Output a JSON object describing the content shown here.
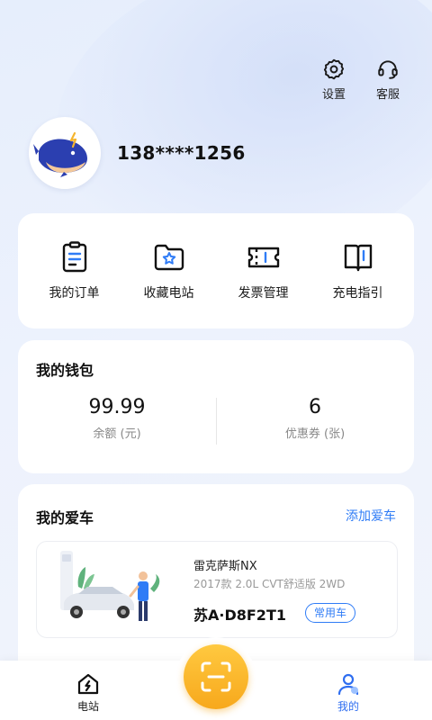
{
  "header": {
    "settings_label": "设置",
    "service_label": "客服"
  },
  "profile": {
    "phone": "138****1256",
    "avatar_icon": "whale-mascot-icon"
  },
  "quick_actions": [
    {
      "label": "我的订单",
      "icon": "order-list-icon"
    },
    {
      "label": "收藏电站",
      "icon": "favorite-station-icon"
    },
    {
      "label": "发票管理",
      "icon": "invoice-ticket-icon"
    },
    {
      "label": "充电指引",
      "icon": "charging-guide-icon"
    }
  ],
  "wallet": {
    "title": "我的钱包",
    "balance_value": "99.99",
    "balance_label": "余额 (元)",
    "coupon_value": "6",
    "coupon_label": "优惠券 (张)"
  },
  "cars": {
    "title": "我的爱车",
    "add_label": "添加爱车",
    "items": [
      {
        "name": "雷克萨斯NX",
        "spec": "2017款 2.0L CVT舒适版 2WD",
        "plate": "苏A·D8F2T1",
        "tag": "常用车"
      }
    ]
  },
  "tabbar": {
    "station_label": "电站",
    "mine_label": "我的",
    "scan_icon": "scan-icon",
    "active_tab": "我的"
  },
  "colors": {
    "accent": "#2f7cf6",
    "scan": "#f7a81c",
    "background": "#e6eefc"
  }
}
